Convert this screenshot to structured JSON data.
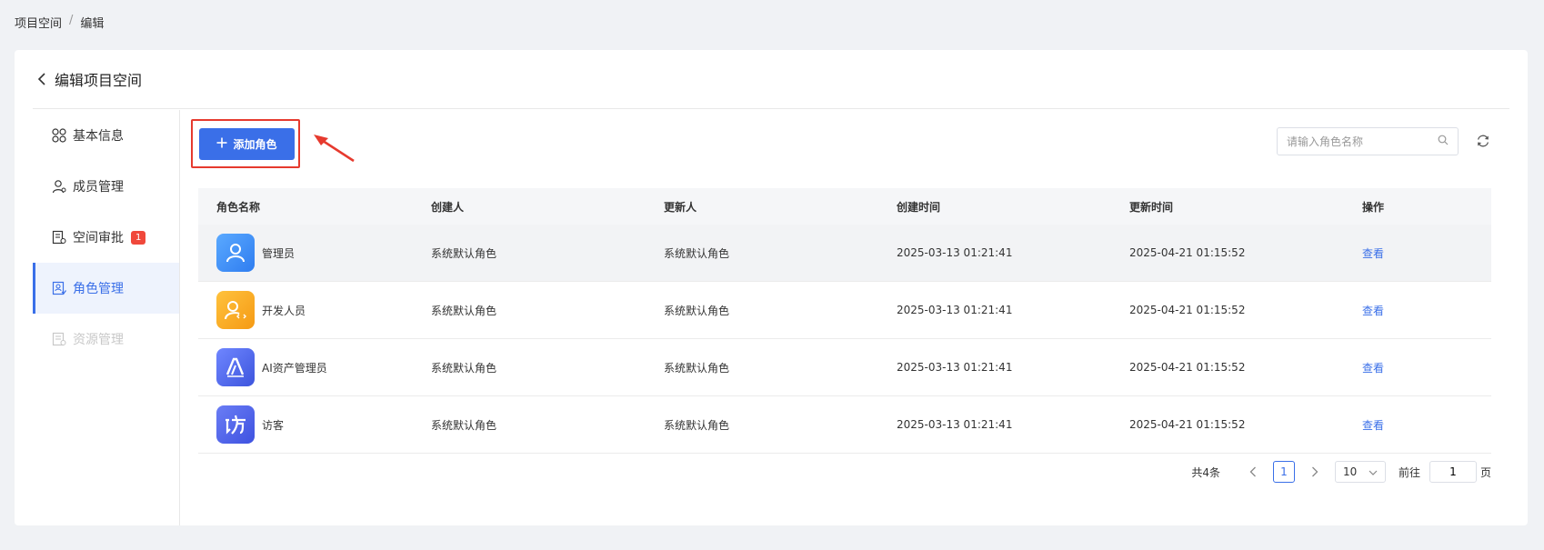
{
  "breadcrumb": {
    "root": "项目空间",
    "separator": "/",
    "current": "编辑"
  },
  "page": {
    "title": "编辑项目空间"
  },
  "sidebar": {
    "items": [
      {
        "label": "基本信息",
        "icon": "grid-icon"
      },
      {
        "label": "成员管理",
        "icon": "member-icon"
      },
      {
        "label": "空间审批",
        "icon": "approval-icon",
        "badge": "1"
      },
      {
        "label": "角色管理",
        "icon": "role-icon",
        "active": true
      },
      {
        "label": "资源管理",
        "icon": "resource-icon",
        "disabled": true
      }
    ]
  },
  "toolbar": {
    "add_label": "添加角色",
    "search_placeholder": "请输入角色名称"
  },
  "table": {
    "headers": [
      "角色名称",
      "创建人",
      "更新人",
      "创建时间",
      "更新时间",
      "操作"
    ],
    "rows": [
      {
        "name": "管理员",
        "avatar_color": "#3d8ef5",
        "creator": "系统默认角色",
        "updater": "系统默认角色",
        "created": "2025-03-13 01:21:41",
        "updated": "2025-04-21 01:15:52",
        "action": "查看"
      },
      {
        "name": "开发人员",
        "avatar_color": "#f5a623",
        "creator": "系统默认角色",
        "updater": "系统默认角色",
        "created": "2025-03-13 01:21:41",
        "updated": "2025-04-21 01:15:52",
        "action": "查看"
      },
      {
        "name": "AI资产管理员",
        "avatar_color": "#5366e8",
        "creator": "系统默认角色",
        "updater": "系统默认角色",
        "created": "2025-03-13 01:21:41",
        "updated": "2025-04-21 01:15:52",
        "action": "查看"
      },
      {
        "name": "访客",
        "avatar_color": "#4f63e6",
        "creator": "系统默认角色",
        "updater": "系统默认角色",
        "created": "2025-03-13 01:21:41",
        "updated": "2025-04-21 01:15:52",
        "action": "查看"
      }
    ]
  },
  "pagination": {
    "total": "共4条",
    "current_page": "1",
    "page_size": "10",
    "goto_prefix": "前往",
    "goto_value": "1",
    "goto_suffix": "页"
  },
  "colors": {
    "primary": "#3a6fe8",
    "highlight": "#e63a2e",
    "badge": "#f0483b"
  }
}
